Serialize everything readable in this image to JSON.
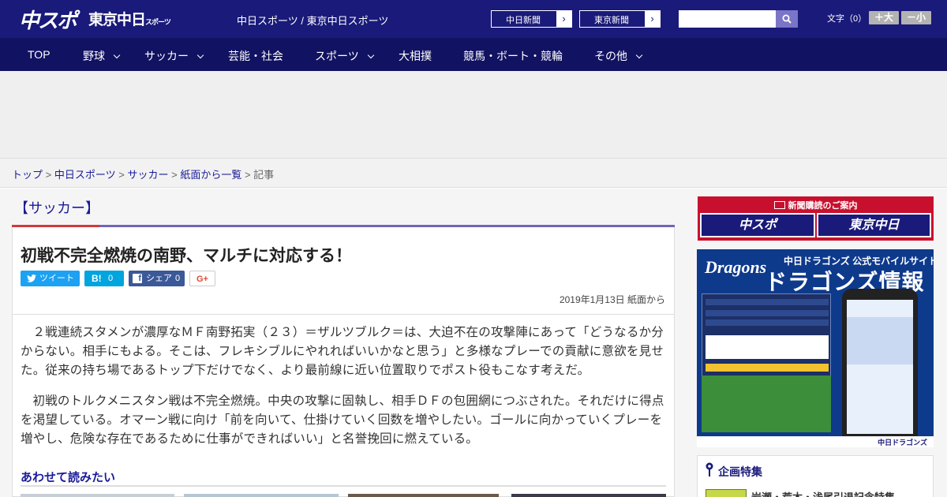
{
  "header": {
    "logo_chunichi": "中スポ",
    "logo_tokyo": "東京中日",
    "logo_tokyo_small": "スポーツ",
    "site_title": "中日スポーツ / 東京中日スポーツ",
    "paper_links": [
      {
        "label": "中日新聞"
      },
      {
        "label": "東京新聞"
      }
    ],
    "search": {
      "placeholder": "",
      "icon": "search-icon"
    },
    "font_size_label": "文字（0）",
    "font_up": "＋大",
    "font_down": "－小"
  },
  "nav": {
    "items": [
      {
        "label": "TOP",
        "has_caret": false
      },
      {
        "label": "野球",
        "has_caret": true
      },
      {
        "label": "サッカー",
        "has_caret": true
      },
      {
        "label": "芸能・社会",
        "has_caret": false
      },
      {
        "label": "スポーツ",
        "has_caret": true
      },
      {
        "label": "大相撲",
        "has_caret": false
      },
      {
        "label": "競馬・ボート・競輪",
        "has_caret": false
      },
      {
        "label": "その他",
        "has_caret": true
      }
    ]
  },
  "breadcrumb": {
    "links": [
      "トップ",
      "中日スポーツ",
      "サッカー",
      "紙面から一覧"
    ],
    "separator": ">",
    "current": "記事"
  },
  "article": {
    "category": "【サッカー】",
    "headline": "初戦不完全燃焼の南野、マルチに対応する！",
    "share": {
      "tweet": "ツイート",
      "hatena_count": "0",
      "facebook": "シェア",
      "facebook_count": "0",
      "gplus": "G+"
    },
    "dateline": "2019年1月13日 紙面から",
    "paragraphs": [
      "２戦連続スタメンが濃厚なＭＦ南野拓実（２３）＝ザルツブルク＝は、大迫不在の攻撃陣にあって「どうなるか分からない。相手にもよる。そこは、フレキシブルにやれればいいかなと思う」と多様なプレーでの貢献に意欲を見せた。従来の持ち場であるトップ下だけでなく、より最前線に近い位置取りでポスト役もこなす考えだ。",
      "初戦のトルクメニスタン戦は不完全燃焼。中央の攻撃に固執し、相手ＤＦの包囲網につぶされた。それだけに得点を渇望している。オマーン戦に向け「前を向いて、仕掛けていく回数を増やしたい。ゴールに向かっていくプレーを増やし、危険な存在であるために仕事ができればいい」と名誉挽回に燃えている。"
    ],
    "related_title": "あわせて読みたい"
  },
  "sidebar": {
    "subscribe_title": "新聞購読のご案内",
    "subscribe_links": [
      "中スポ",
      "東京中日"
    ],
    "banner": {
      "logo": "Dragons",
      "subtitle": "中日ドラゴンズ 公式モバイルサイト",
      "title": "ドラゴンズ情報",
      "footer": "中日ドラゴンズ"
    },
    "feature_title": "企画特集",
    "feature_item": "岩瀬・荒木・浅尾引退記念特集"
  },
  "colors": {
    "header_bg": "#1a1a7a",
    "nav_bg": "#121262",
    "category_accent": "#d03a3a",
    "link": "#1a1a9a",
    "twitter": "#1da1f2",
    "hatena": "#00a4de",
    "facebook": "#3b5998"
  }
}
